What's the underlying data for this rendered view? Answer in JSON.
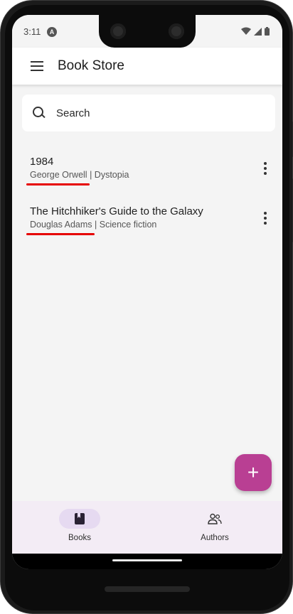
{
  "status_bar": {
    "time": "3:11",
    "app_icon": "A"
  },
  "app_bar": {
    "title": "Book Store"
  },
  "search": {
    "placeholder": "Search",
    "value": ""
  },
  "books": [
    {
      "title": "1984",
      "author": "George Orwell",
      "separator": " | ",
      "genre": "Dystopia",
      "underline_color": "#e60000"
    },
    {
      "title": "The Hitchhiker's Guide to the Galaxy",
      "author": "Douglas Adams",
      "separator": " | ",
      "genre": "Science fiction",
      "underline_color": "#e60000"
    }
  ],
  "fab": {
    "label": "+",
    "color": "#b93f93"
  },
  "bottom_nav": {
    "items": [
      {
        "label": "Books",
        "icon": "book-icon",
        "active": true
      },
      {
        "label": "Authors",
        "icon": "people-icon",
        "active": false
      }
    ]
  },
  "colors": {
    "accent": "#b93f93",
    "nav_background": "#f3ecf5",
    "nav_active_pill": "#e6daf1"
  }
}
